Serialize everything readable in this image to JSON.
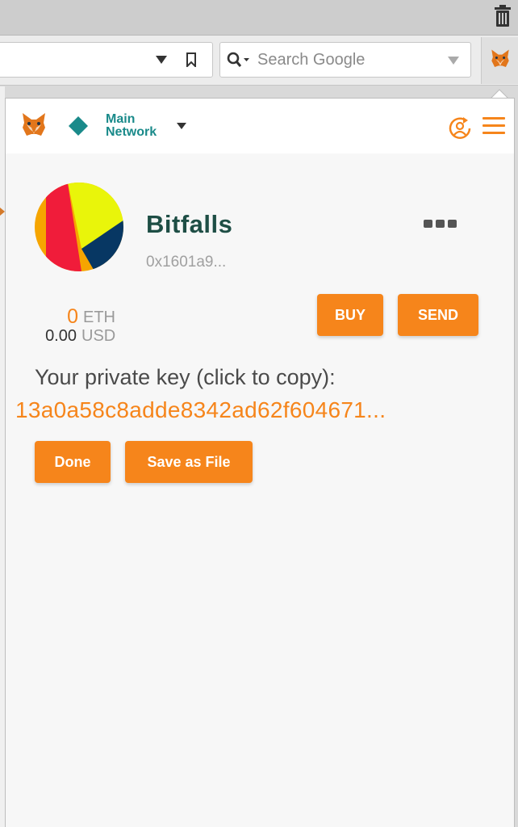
{
  "browser": {
    "search_placeholder": "Search Google"
  },
  "header": {
    "network_line1": "Main",
    "network_line2": "Network"
  },
  "account": {
    "name": "Bitfalls",
    "address": "0x1601a9...",
    "identicon_colors": [
      "#f6a500",
      "#f01c3a",
      "#e9f50a",
      "#073763"
    ]
  },
  "balance": {
    "eth_value": "0",
    "eth_unit": "ETH",
    "usd_value": "0.00",
    "usd_unit": "USD"
  },
  "actions": {
    "buy_label": "BUY",
    "send_label": "SEND"
  },
  "private_key": {
    "label": "Your private key (click to copy):",
    "value": "13a0a58c8adde8342ad62f604671..."
  },
  "buttons": {
    "done_label": "Done",
    "save_label": "Save as File"
  },
  "colors": {
    "accent": "#f6851b",
    "account_name": "#1e4e45",
    "network": "#1a8a8a"
  }
}
